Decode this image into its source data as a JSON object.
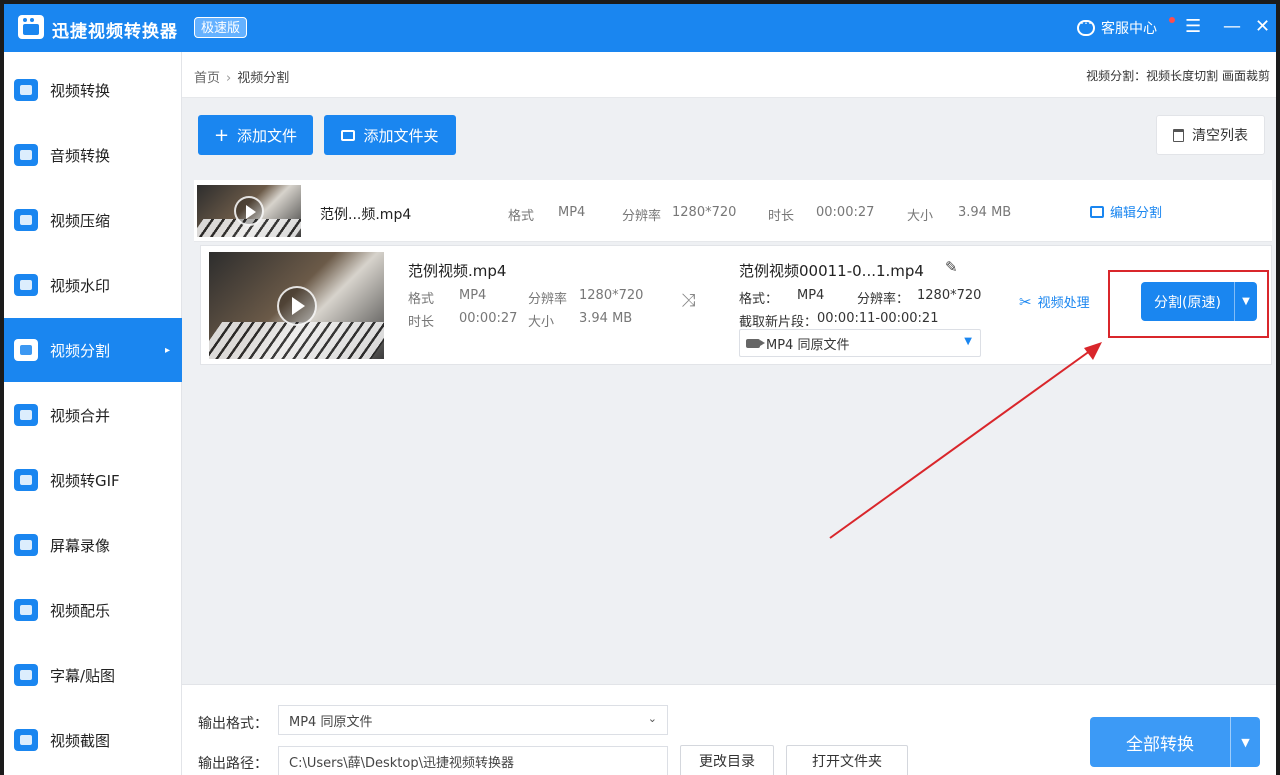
{
  "titlebar": {
    "app_name": "迅捷视频转换器",
    "badge": "极速版",
    "support": "客服中心",
    "menu_glyph": "☰",
    "min_glyph": "—",
    "close_glyph": "✕"
  },
  "sidebar": {
    "items": [
      {
        "label": "视频转换",
        "icon": "video-convert-icon"
      },
      {
        "label": "音频转换",
        "icon": "audio-convert-icon"
      },
      {
        "label": "视频压缩",
        "icon": "video-compress-icon"
      },
      {
        "label": "视频水印",
        "icon": "video-watermark-icon"
      },
      {
        "label": "视频分割",
        "icon": "video-split-icon",
        "active": true
      },
      {
        "label": "视频合并",
        "icon": "video-merge-icon"
      },
      {
        "label": "视频转GIF",
        "icon": "video-gif-icon"
      },
      {
        "label": "屏幕录像",
        "icon": "screen-record-icon"
      },
      {
        "label": "视频配乐",
        "icon": "video-music-icon"
      },
      {
        "label": "字幕/贴图",
        "icon": "subtitle-sticker-icon"
      },
      {
        "label": "视频截图",
        "icon": "video-screenshot-icon"
      }
    ],
    "active_arrow": "▸"
  },
  "breadcrumb": {
    "home": "首页",
    "sep": "›",
    "current": "视频分割",
    "hint": "视频分割：视频长度切割 画面裁剪"
  },
  "toolbar": {
    "add_file": "添加文件",
    "add_file_glyph": "+",
    "add_folder": "添加文件夹",
    "clear_list": "清空列表"
  },
  "file1": {
    "name": "范例...频.mp4",
    "format_label": "格式",
    "format": "MP4",
    "resolution_label": "分辨率",
    "resolution": "1280*720",
    "duration_label": "时长",
    "duration": "00:00:27",
    "size_label": "大小",
    "size": "3.94 MB",
    "edit_split": "编辑分割"
  },
  "file2": {
    "name": "范例视频.mp4",
    "format_label": "格式",
    "format": "MP4",
    "resolution_label": "分辨率",
    "resolution": "1280*720",
    "duration_label": "时长",
    "duration": "00:00:27",
    "size_label": "大小",
    "size": "3.94 MB",
    "shuffle_glyph": "⤨",
    "output_name": "范例视频00011-0...1.mp4",
    "pencil_glyph": "✎",
    "out_format_label": "格式：",
    "out_format": "MP4",
    "out_resolution_label": "分辨率：",
    "out_resolution": "1280*720",
    "clip_label": "截取新片段：",
    "clip_range": "00:00:11-00:00:21",
    "format_select": "MP4  同原文件",
    "select_caret": "▼",
    "video_process": "视频处理",
    "scissors_glyph": "✂",
    "split_button": "分割(原速)",
    "split_caret": "▼"
  },
  "bottom": {
    "output_format_label": "输出格式：",
    "output_format_value": "MP4  同原文件",
    "format_caret": "⌄",
    "output_path_label": "输出路径：",
    "output_path_value": "C:\\Users\\薛\\Desktop\\迅捷视频转换器",
    "change_dir": "更改目录",
    "open_folder": "打开文件夹",
    "convert_all": "全部转换",
    "convert_caret": "▼"
  },
  "colors": {
    "brand_blue": "#1a86f0",
    "highlight_red": "#d9262b"
  }
}
